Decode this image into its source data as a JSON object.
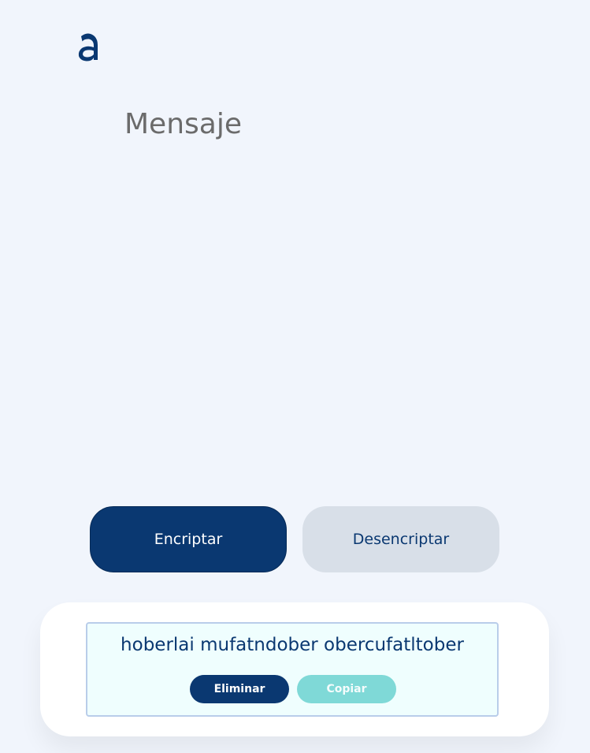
{
  "logo": {
    "icon": "alura-a-logo-icon",
    "color": "#0a3871"
  },
  "message": {
    "placeholder": "Mensaje",
    "value": ""
  },
  "buttons": {
    "encrypt_label": "Encriptar",
    "decrypt_label": "Desencriptar"
  },
  "result": {
    "text": "hoberlai mufatndober obercufatltober",
    "delete_label": "Eliminar",
    "copy_label": "Copiar"
  },
  "colors": {
    "background": "#f1f5fc",
    "primary": "#0a3871",
    "secondary": "#d8dfe8",
    "copy_button": "#7fd9d7",
    "result_box": "#effefe"
  }
}
